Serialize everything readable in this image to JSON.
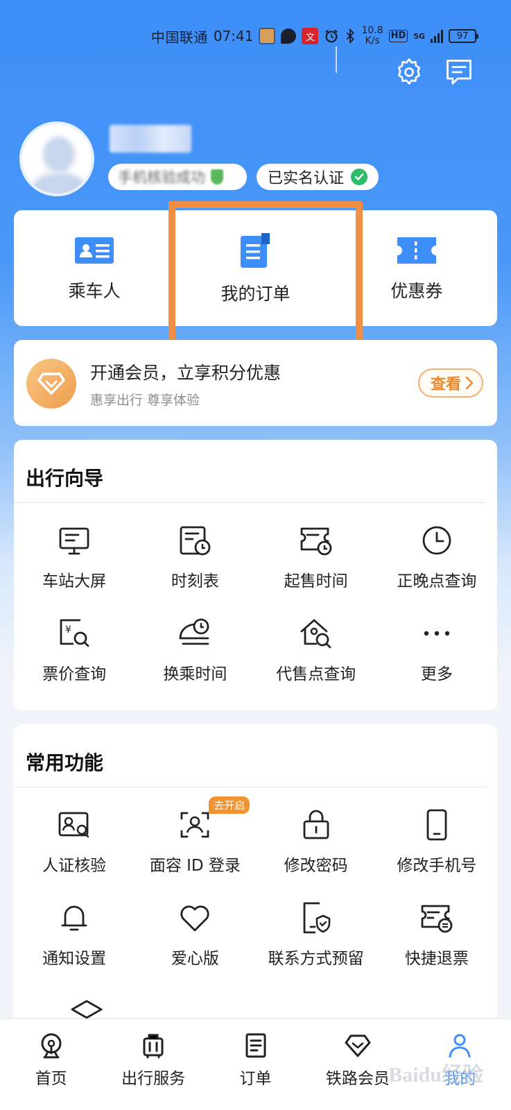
{
  "status_bar": {
    "carrier": "中国联通",
    "time": "07:41",
    "speed_value": "10.8",
    "speed_unit": "K/s",
    "network": "HD",
    "network_gen": "5G",
    "battery": "97"
  },
  "header": {
    "settings_icon": "gear-icon",
    "message_icon": "message-icon"
  },
  "profile": {
    "name": "",
    "phone_status": "手机核验成功",
    "verified_label": "已实名认证"
  },
  "quick_actions": [
    {
      "label": "乘车人",
      "icon": "passenger-card-icon"
    },
    {
      "label": "我的订单",
      "icon": "order-doc-icon"
    },
    {
      "label": "优惠券",
      "icon": "coupon-icon"
    }
  ],
  "member_banner": {
    "title": "开通会员，立享积分优惠",
    "subtitle": "惠享出行 尊享体验",
    "button": "查看",
    "icon": "diamond-icon"
  },
  "travel_guide": {
    "title": "出行向导",
    "items": [
      {
        "label": "车站大屏",
        "icon": "station-screen-icon"
      },
      {
        "label": "时刻表",
        "icon": "timetable-icon"
      },
      {
        "label": "起售时间",
        "icon": "ticket-clock-icon"
      },
      {
        "label": "正晚点查询",
        "icon": "clock-icon"
      },
      {
        "label": "票价查询",
        "icon": "price-search-icon"
      },
      {
        "label": "换乘时间",
        "icon": "transfer-time-icon"
      },
      {
        "label": "代售点查询",
        "icon": "agency-search-icon"
      },
      {
        "label": "更多",
        "icon": "more-icon"
      }
    ]
  },
  "common_functions": {
    "title": "常用功能",
    "items": [
      {
        "label": "人证核验",
        "icon": "id-verify-icon"
      },
      {
        "label": "面容 ID 登录",
        "icon": "face-id-icon",
        "badge": "去开启"
      },
      {
        "label": "修改密码",
        "icon": "lock-icon"
      },
      {
        "label": "修改手机号",
        "icon": "phone-icon"
      },
      {
        "label": "通知设置",
        "icon": "bell-icon"
      },
      {
        "label": "爱心版",
        "icon": "heart-icon"
      },
      {
        "label": "联系方式预留",
        "icon": "contact-shield-icon"
      },
      {
        "label": "快捷退票",
        "icon": "quick-refund-icon"
      }
    ]
  },
  "bottom_nav": [
    {
      "label": "首页",
      "icon": "train-home-icon"
    },
    {
      "label": "出行服务",
      "icon": "luggage-icon"
    },
    {
      "label": "订单",
      "icon": "order-icon"
    },
    {
      "label": "铁路会员",
      "icon": "member-diamond-icon"
    },
    {
      "label": "我的",
      "icon": "user-icon",
      "active": true
    }
  ],
  "colors": {
    "primary": "#3d8ef8",
    "accent_orange": "#ef8e46",
    "verified_green": "#2ebd6b"
  },
  "watermark": "Baidu经验"
}
